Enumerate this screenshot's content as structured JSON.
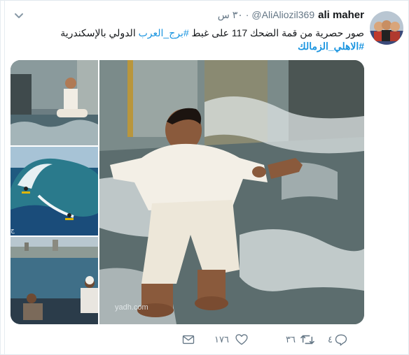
{
  "tweet": {
    "display_name": "ali maher",
    "handle": "@AliAliozil369",
    "separator": "·",
    "time": "٣٠ س",
    "text_line1_before": "صور حصرية من قمة الضحك 117 على غبط ",
    "hashtag1": "#برج_العرب",
    "text_line1_after": " الدولي بالإسكندرية",
    "hashtag2": "#الاهلي_الزمالك"
  },
  "media": {
    "watermark": "yadh.com",
    "thumb2_mark": "ج"
  },
  "actions": {
    "reply_count": "٤",
    "retweet_count": "٣٦",
    "like_count": "١٧٦"
  },
  "colors": {
    "link": "#1b95e0",
    "muted": "#657786",
    "text": "#14171a"
  },
  "icons": {
    "caret": "chevron-down-icon",
    "reply": "reply-icon",
    "retweet": "retweet-icon",
    "like": "heart-icon",
    "dm": "envelope-icon"
  }
}
